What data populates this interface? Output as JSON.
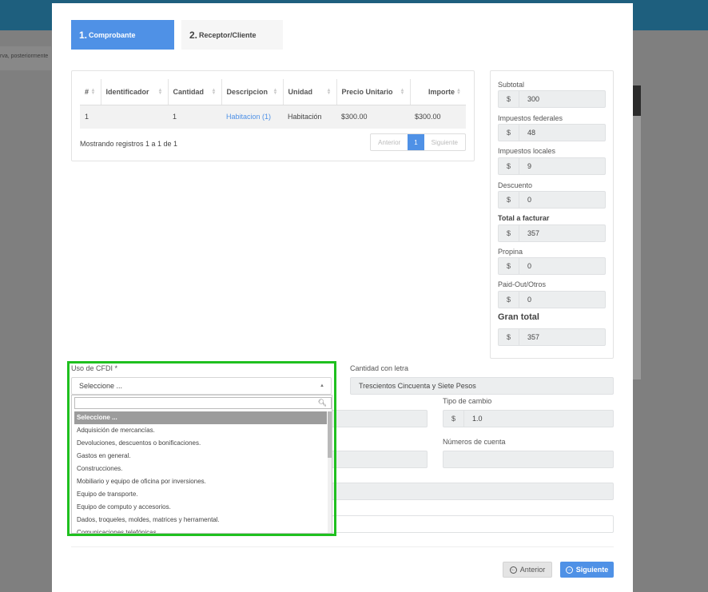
{
  "background": {
    "left_text": "rva, posteriormente"
  },
  "steps": [
    {
      "num": "1.",
      "label": "Comprobante"
    },
    {
      "num": "2.",
      "label": "Receptor/Cliente"
    }
  ],
  "table": {
    "headers": [
      "#",
      "Identificador",
      "Cantidad",
      "Descripcion",
      "Unidad",
      "Precio Unitario",
      "Importe"
    ],
    "rows": [
      [
        "1",
        "",
        "1",
        "Habitacion (1)",
        "Habitación",
        "$300.00",
        "$300.00"
      ]
    ],
    "info": "Mostrando registros 1 a 1 de 1",
    "pager": {
      "prev": "Anterior",
      "page": "1",
      "next": "Siguiente"
    }
  },
  "totals": {
    "currency": "$",
    "items": [
      {
        "label": "Subtotal",
        "value": "300"
      },
      {
        "label": "Impuestos federales",
        "value": "48"
      },
      {
        "label": "Impuestos locales",
        "value": "9"
      },
      {
        "label": "Descuento",
        "value": "0"
      },
      {
        "label": "Total a facturar",
        "value": "357"
      },
      {
        "label": "Propina",
        "value": "0"
      },
      {
        "label": "Paid-Out/Otros",
        "value": "0"
      },
      {
        "label": "Gran total",
        "value": "357"
      }
    ]
  },
  "form": {
    "uso_cfdi_label": "Uso de CFDI *",
    "uso_cfdi_value": "Seleccione ...",
    "cantidad_letra_label": "Cantidad con letra",
    "cantidad_letra_value": "Trescientos Cincuenta y Siete Pesos",
    "tipo_cambio_label": "Tipo de cambio",
    "tipo_cambio_currency": "$",
    "tipo_cambio_value": "1.0",
    "numeros_cuenta_label": "Números de cuenta"
  },
  "dropdown": {
    "search_value": "",
    "options": [
      "Seleccione ...",
      "Adquisición de mercancías.",
      "Devoluciones, descuentos o bonificaciones.",
      "Gastos en general.",
      "Construcciones.",
      "Mobiliario y equipo de oficina por inversiones.",
      "Equipo de transporte.",
      "Equipo de computo y accesorios.",
      "Dados, troqueles, moldes, matrices y herramental.",
      "Comunicaciones telefónicas."
    ]
  },
  "buttons": {
    "prev": "Anterior",
    "next": "Siguiente"
  },
  "colors": {
    "primary": "#4f91e6",
    "highlight": "#1fc01f",
    "header_bar": "#1e5f7e"
  }
}
